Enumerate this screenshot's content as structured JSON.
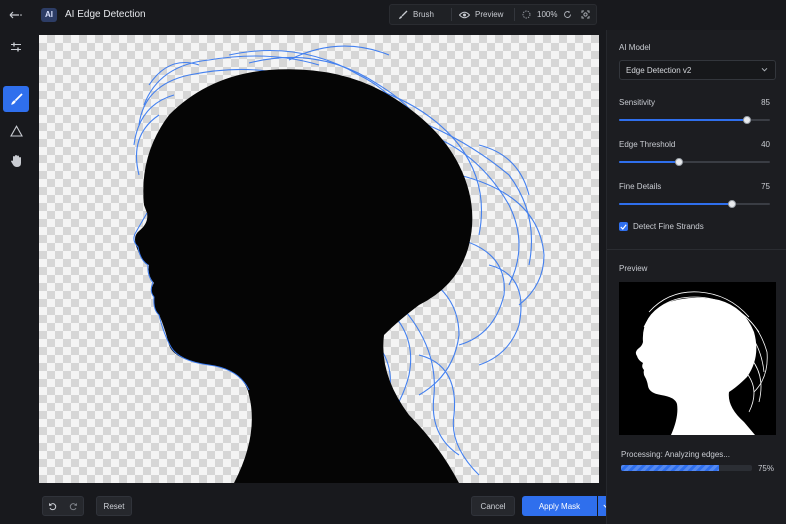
{
  "app": {
    "badge": "AI",
    "title": "AI Edge Detection"
  },
  "toolbar": {
    "brush_label": "Brush",
    "preview_label": "Preview",
    "zoom": "100%"
  },
  "left_tools": [
    "back-icon",
    "adjust-icon",
    "brush-icon",
    "triangle-icon",
    "hand-icon"
  ],
  "bottom": {
    "reset_label": "Reset",
    "cancel_label": "Cancel",
    "apply_label": "Apply Mask"
  },
  "panel": {
    "model_label": "AI Model",
    "model_value": "Edge Detection v2",
    "sliders": [
      {
        "label": "Sensitivity",
        "value": "85",
        "level": 0.85
      },
      {
        "label": "Edge Threshold",
        "value": "40",
        "level": 0.4
      },
      {
        "label": "Fine Details",
        "value": "75",
        "level": 0.75
      }
    ],
    "checkbox_label": "Detect Fine Strands",
    "checkbox_checked": true,
    "preview_label": "Preview",
    "processing_text": "Processing: Analyzing edges...",
    "progress_text": "75%",
    "progress_level": 0.75
  },
  "colors": {
    "accent": "#2f6fed",
    "background": "#18191d",
    "panel": "#1c1d21",
    "edge_overlay": "#3b7bf0"
  }
}
